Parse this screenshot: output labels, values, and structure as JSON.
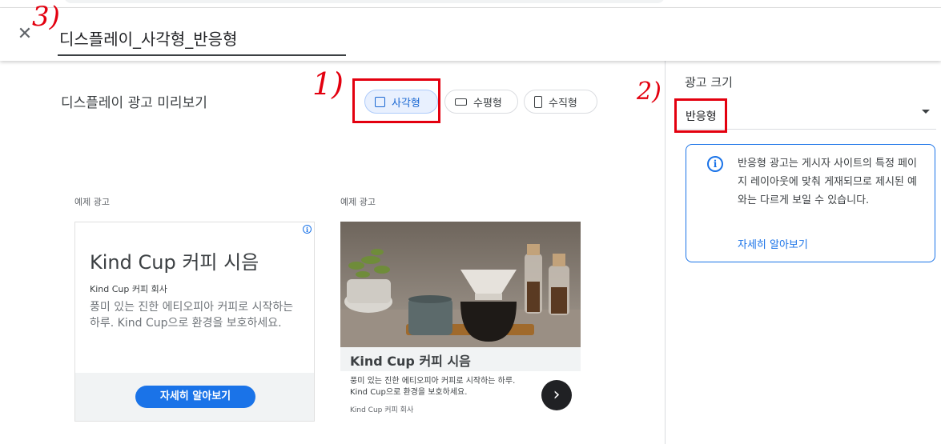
{
  "header": {
    "close_icon": "close-icon",
    "close_glyph": "✕",
    "ad_name_value": "디스플레이_사각형_반응형"
  },
  "annotations": {
    "one": "1)",
    "two": "2)",
    "three": "3)",
    "color": "#e3000f"
  },
  "preview": {
    "title": "디스플레이 광고 미리보기",
    "formats": [
      {
        "label": "사각형",
        "icon": "square-icon",
        "selected": true
      },
      {
        "label": "수평형",
        "icon": "horizontal-rect-icon",
        "selected": false
      },
      {
        "label": "수직형",
        "icon": "vertical-rect-icon",
        "selected": false
      }
    ],
    "ads": [
      {
        "label": "예제 광고",
        "headline": "Kind Cup 커피 시음",
        "business": "Kind Cup 커피 회사",
        "description": "풍미 있는 진한 에티오피아 커피로 시작하는 하루. Kind Cup으로 환경을 보호하세요.",
        "cta": "자세히 알아보기",
        "adchoices_glyph": "i"
      },
      {
        "label": "예제 광고",
        "headline": "Kind Cup 커피 시음",
        "description": "풍미 있는 진한 에티오피아 커피로 시작하는 하루. Kind Cup으로 환경을 보호하세요.",
        "business": "Kind Cup 커피 회사",
        "next_glyph": "›"
      }
    ]
  },
  "sidebar": {
    "title": "광고 크기",
    "size_select": {
      "value": "반응형",
      "icon": "dropdown-arrow-icon"
    },
    "info": {
      "icon": "info-icon",
      "glyph": "i",
      "text": "반응형 광고는 게시자 사이트의 특정 페이지 레이아웃에 맞춰 게재되므로 제시된 예와는 다르게 보일 수 있습니다.",
      "link": "자세히 알아보기"
    }
  },
  "colors": {
    "accent": "#1a73e8",
    "selected_chip_bg": "#e8f0fe",
    "annotation_red": "#e3000f"
  }
}
